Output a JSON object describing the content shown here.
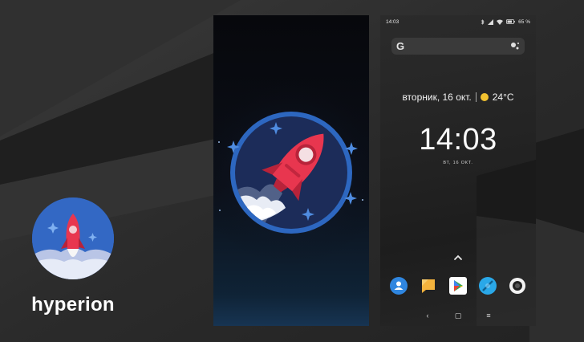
{
  "app": {
    "name": "hyperion",
    "icon": "rocket-icon"
  },
  "phone": {
    "status_bar": {
      "time": "14:03",
      "battery": "65 %",
      "icons": [
        "bluetooth-icon",
        "signal-icon",
        "wifi-icon",
        "battery-icon"
      ]
    },
    "search": {
      "logo": "G",
      "icon": "assistant-icon"
    },
    "weather": {
      "date": "вторник, 16 окт.",
      "temperature": "24°C",
      "icon": "sun-icon"
    },
    "clock": {
      "time": "14:03",
      "date_short": "ВТ, 16 ОКТ."
    },
    "dock": [
      "contacts-icon",
      "messages-icon",
      "play-store-icon",
      "browser-icon",
      "camera-icon"
    ],
    "nav": {
      "back": "‹",
      "home": "▢",
      "menu": "≡"
    }
  },
  "colors": {
    "rocket_red": "#e8364f",
    "ring_blue": "#2d67c0",
    "circle_navy": "#1c2c59",
    "sparkle": "#4f8ce0"
  }
}
